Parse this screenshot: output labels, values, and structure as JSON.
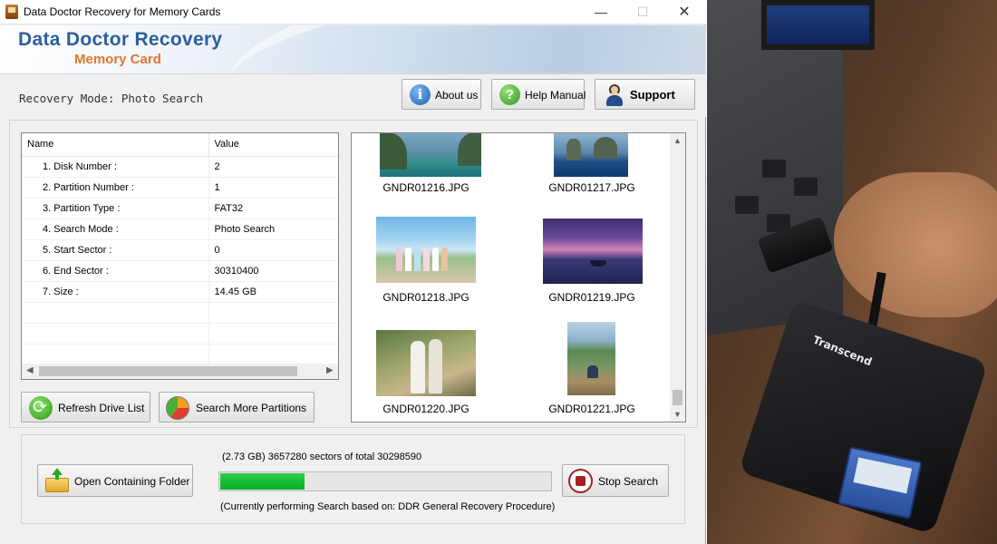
{
  "window": {
    "title": "Data Doctor Recovery for Memory Cards",
    "min_glyph": "—",
    "max_glyph": "☐",
    "close_glyph": "✕"
  },
  "banner": {
    "line1": "Data Doctor Recovery",
    "line2": "Memory Card"
  },
  "mode_label": "Recovery Mode: Photo Search",
  "toolbar": {
    "about_label": "About us",
    "help_label": "Help Manual",
    "support_label": "Support",
    "about_icon": "info-icon",
    "help_icon": "help-icon",
    "support_icon": "support-person-icon"
  },
  "details": {
    "headers": [
      "Name",
      "Value"
    ],
    "rows": [
      {
        "name": "1. Disk Number :",
        "value": "2"
      },
      {
        "name": "2. Partition Number :",
        "value": "1"
      },
      {
        "name": "3. Partition Type :",
        "value": "FAT32"
      },
      {
        "name": "4. Search Mode :",
        "value": "Photo Search"
      },
      {
        "name": "5. Start Sector :",
        "value": "0"
      },
      {
        "name": "6. End Sector :",
        "value": "30310400"
      },
      {
        "name": "7. Size :",
        "value": "14.45 GB"
      }
    ]
  },
  "buttons": {
    "refresh_label": "Refresh Drive List",
    "more_label": "Search More Partitions",
    "open_label": "Open Containing Folder",
    "stop_label": "Stop Search"
  },
  "photos": [
    {
      "name": "GNDR01216.JPG"
    },
    {
      "name": "GNDR01217.JPG"
    },
    {
      "name": "GNDR01218.JPG"
    },
    {
      "name": "GNDR01219.JPG"
    },
    {
      "name": "GNDR01220.JPG"
    },
    {
      "name": "GNDR01221.JPG"
    }
  ],
  "progress": {
    "sectors_text": "(2.73 GB) 3657280  sectors  of  total 30298590",
    "fraction": 0.2566,
    "status_text": "(Currently performing Search based on:  DDR General Recovery Procedure)"
  },
  "side_photo": {
    "reader_brand": "Transcend"
  },
  "colors": {
    "brand_blue": "#2c5f9c",
    "brand_orange": "#e4762a",
    "progress_green": "#06b025"
  }
}
